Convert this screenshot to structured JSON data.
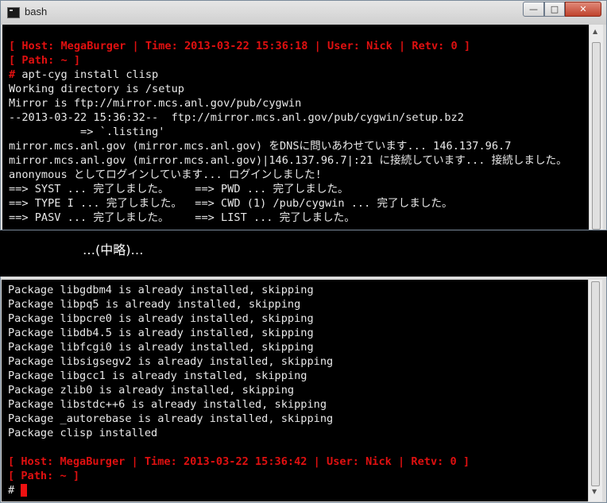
{
  "window": {
    "title": "bash",
    "minimize_glyph": "—",
    "maximize_glyph": "□",
    "close_glyph": "✕"
  },
  "top_session": {
    "status": "[ Host: MegaBurger | Time: 2013-03-22 15:36:18 | User: Nick | Retv: 0 ]",
    "path": "[ Path: ~ ]",
    "prompt": "#",
    "command": " apt-cyg install clisp",
    "output": [
      "Working directory is /setup",
      "Mirror is ftp://mirror.mcs.anl.gov/pub/cygwin",
      "--2013-03-22 15:36:32--  ftp://mirror.mcs.anl.gov/pub/cygwin/setup.bz2",
      "           => `.listing'",
      "mirror.mcs.anl.gov (mirror.mcs.anl.gov) をDNSに問いあわせています... 146.137.96.7",
      "mirror.mcs.anl.gov (mirror.mcs.anl.gov)|146.137.96.7|:21 に接続しています... 接続しました。",
      "anonymous としてログインしています... ログインしました!",
      "==> SYST ... 完了しました。    ==> PWD ... 完了しました。",
      "==> TYPE I ... 完了しました。  ==> CWD (1) /pub/cygwin ... 完了しました。",
      "==> PASV ... 完了しました。    ==> LIST ... 完了しました。"
    ]
  },
  "omission_text": "…(中略)…",
  "bottom_session": {
    "output": [
      "Package libgdbm4 is already installed, skipping",
      "Package libpq5 is already installed, skipping",
      "Package libpcre0 is already installed, skipping",
      "Package libdb4.5 is already installed, skipping",
      "Package libfcgi0 is already installed, skipping",
      "Package libsigsegv2 is already installed, skipping",
      "Package libgcc1 is already installed, skipping",
      "Package zlib0 is already installed, skipping",
      "Package libstdc++6 is already installed, skipping",
      "Package _autorebase is already installed, skipping",
      "Package clisp installed"
    ],
    "status": "[ Host: MegaBurger | Time: 2013-03-22 15:36:42 | User: Nick | Retv: 0 ]",
    "path": "[ Path: ~ ]",
    "prompt": "#"
  },
  "scrollbar": {
    "up_glyph": "▲",
    "down_glyph": "▼"
  },
  "colors": {
    "prompt_red": "#e01010",
    "cursor": "#ee1111",
    "terminal_bg": "#000000",
    "terminal_fg": "#e8e8e8"
  }
}
